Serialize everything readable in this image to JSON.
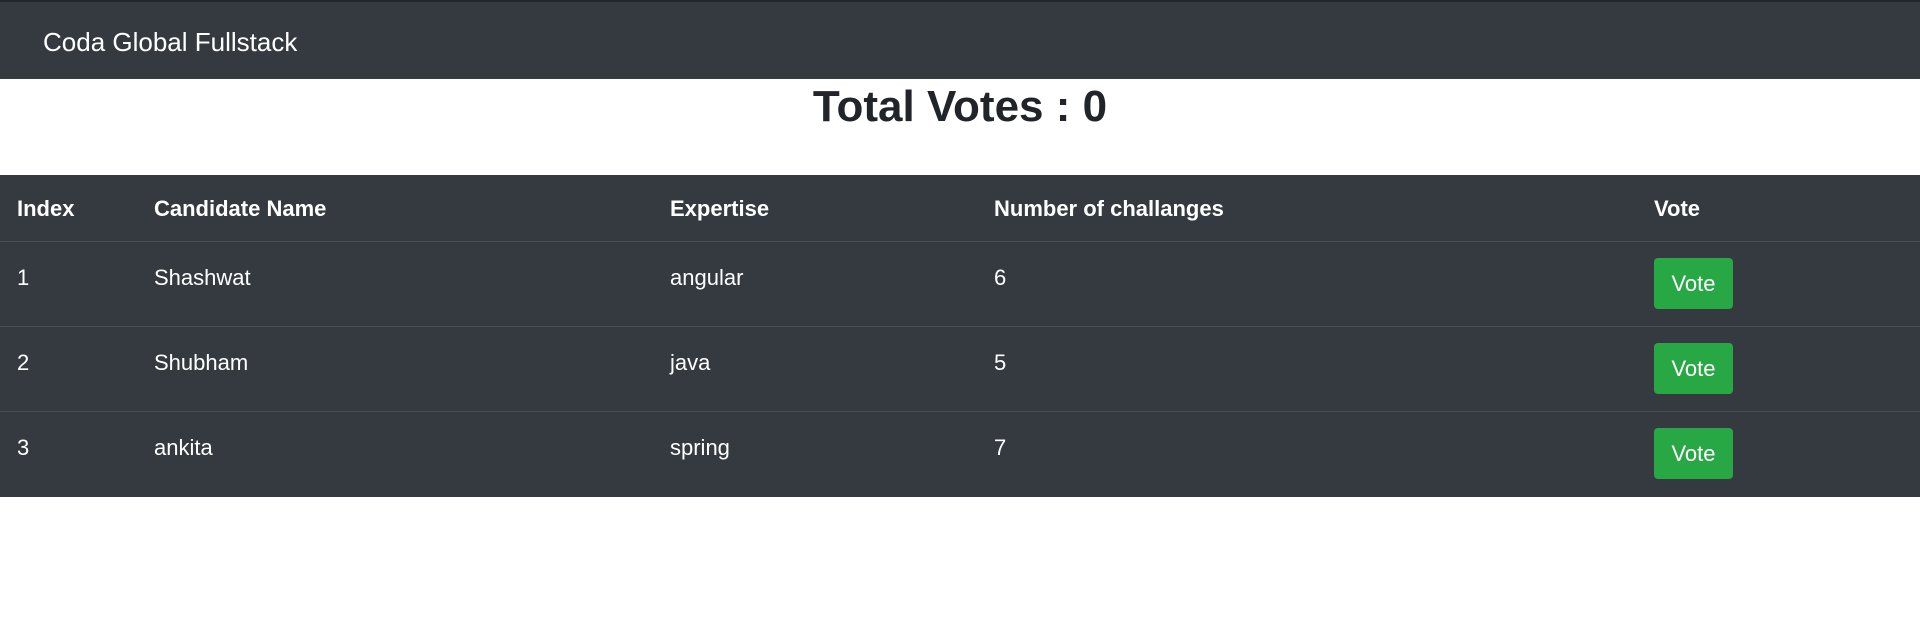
{
  "navbar": {
    "brand": "Coda Global Fullstack"
  },
  "summary": {
    "total_votes_text": "Total Votes : 0"
  },
  "table": {
    "headers": [
      "Index",
      "Candidate Name",
      "Expertise",
      "Number of challanges",
      "Vote"
    ],
    "rows": [
      {
        "index": "1",
        "name": "Shashwat",
        "expertise": "angular",
        "challenges": "6",
        "vote_label": "Vote"
      },
      {
        "index": "2",
        "name": "Shubham",
        "expertise": "java",
        "challenges": "5",
        "vote_label": "Vote"
      },
      {
        "index": "3",
        "name": "ankita",
        "expertise": "spring",
        "challenges": "7",
        "vote_label": "Vote"
      }
    ]
  },
  "colors": {
    "navbar_bg": "#343a40",
    "table_bg": "#343a40",
    "vote_button": "#28a745",
    "heading_text": "#212529"
  }
}
